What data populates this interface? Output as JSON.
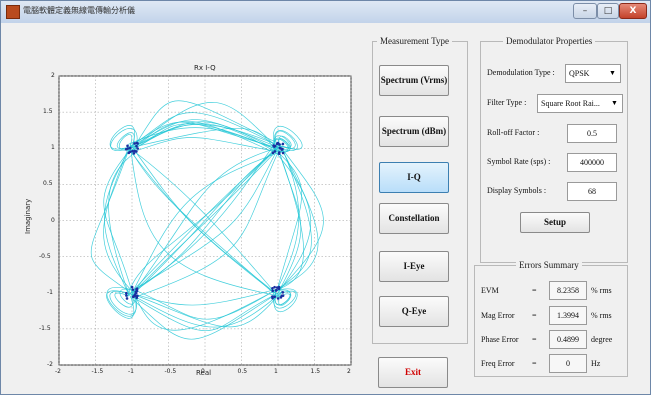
{
  "window": {
    "title": "電腦軟體定義無線電傳輸分析儀",
    "buttons": {
      "minimize": "–",
      "maximize": "□",
      "close": "X"
    }
  },
  "plot": {
    "title": "Rx I-Q",
    "xlabel": "Real",
    "ylabel": "Imaginary",
    "xticks": [
      "-2",
      "-1.5",
      "-1",
      "-0.5",
      "0",
      "0.5",
      "1",
      "1.5",
      "2"
    ],
    "yticks": [
      "2",
      "1.5",
      "1",
      "0.5",
      "0",
      "-0.5",
      "-1",
      "-1.5",
      "-2"
    ],
    "xlim": [
      -2,
      2
    ],
    "ylim": [
      -2,
      2
    ],
    "grid": true,
    "trace_color": "#23c7d6",
    "symbol_color": "#1a2fa0",
    "constellation_points": [
      [
        -1,
        1
      ],
      [
        1,
        1
      ],
      [
        -1,
        -1
      ],
      [
        1,
        -1
      ]
    ]
  },
  "measurement_type": {
    "title": "Measurement Type",
    "buttons": [
      "Spectrum (Vrms)",
      "Spectrum (dBm)",
      "I-Q",
      "Constellation",
      "I-Eye",
      "Q-Eye"
    ],
    "active": "I-Q",
    "exit_label": "Exit"
  },
  "demod": {
    "title": "Demodulator Properties",
    "type_label": "Demodulation Type :",
    "type_value": "QPSK",
    "filter_label": "Filter Type :",
    "filter_value": "Square Root Rai...",
    "rolloff_label": "Roll-off Factor :",
    "rolloff_value": "0.5",
    "symrate_label": "Symbol Rate (sps) :",
    "symrate_value": "400000",
    "display_label": "Display Symbols :",
    "display_value": "68",
    "setup_label": "Setup"
  },
  "errors": {
    "title": "Errors Summary",
    "rows": [
      {
        "label": "EVM",
        "eq": "=",
        "value": "8.2358",
        "unit": "% rms"
      },
      {
        "label": "Mag Error",
        "eq": "=",
        "value": "1.3994",
        "unit": "% rms"
      },
      {
        "label": "Phase Error",
        "eq": "=",
        "value": "0.4899",
        "unit": "degree"
      },
      {
        "label": "Freq Error",
        "eq": "=",
        "value": "0",
        "unit": "Hz"
      }
    ]
  }
}
